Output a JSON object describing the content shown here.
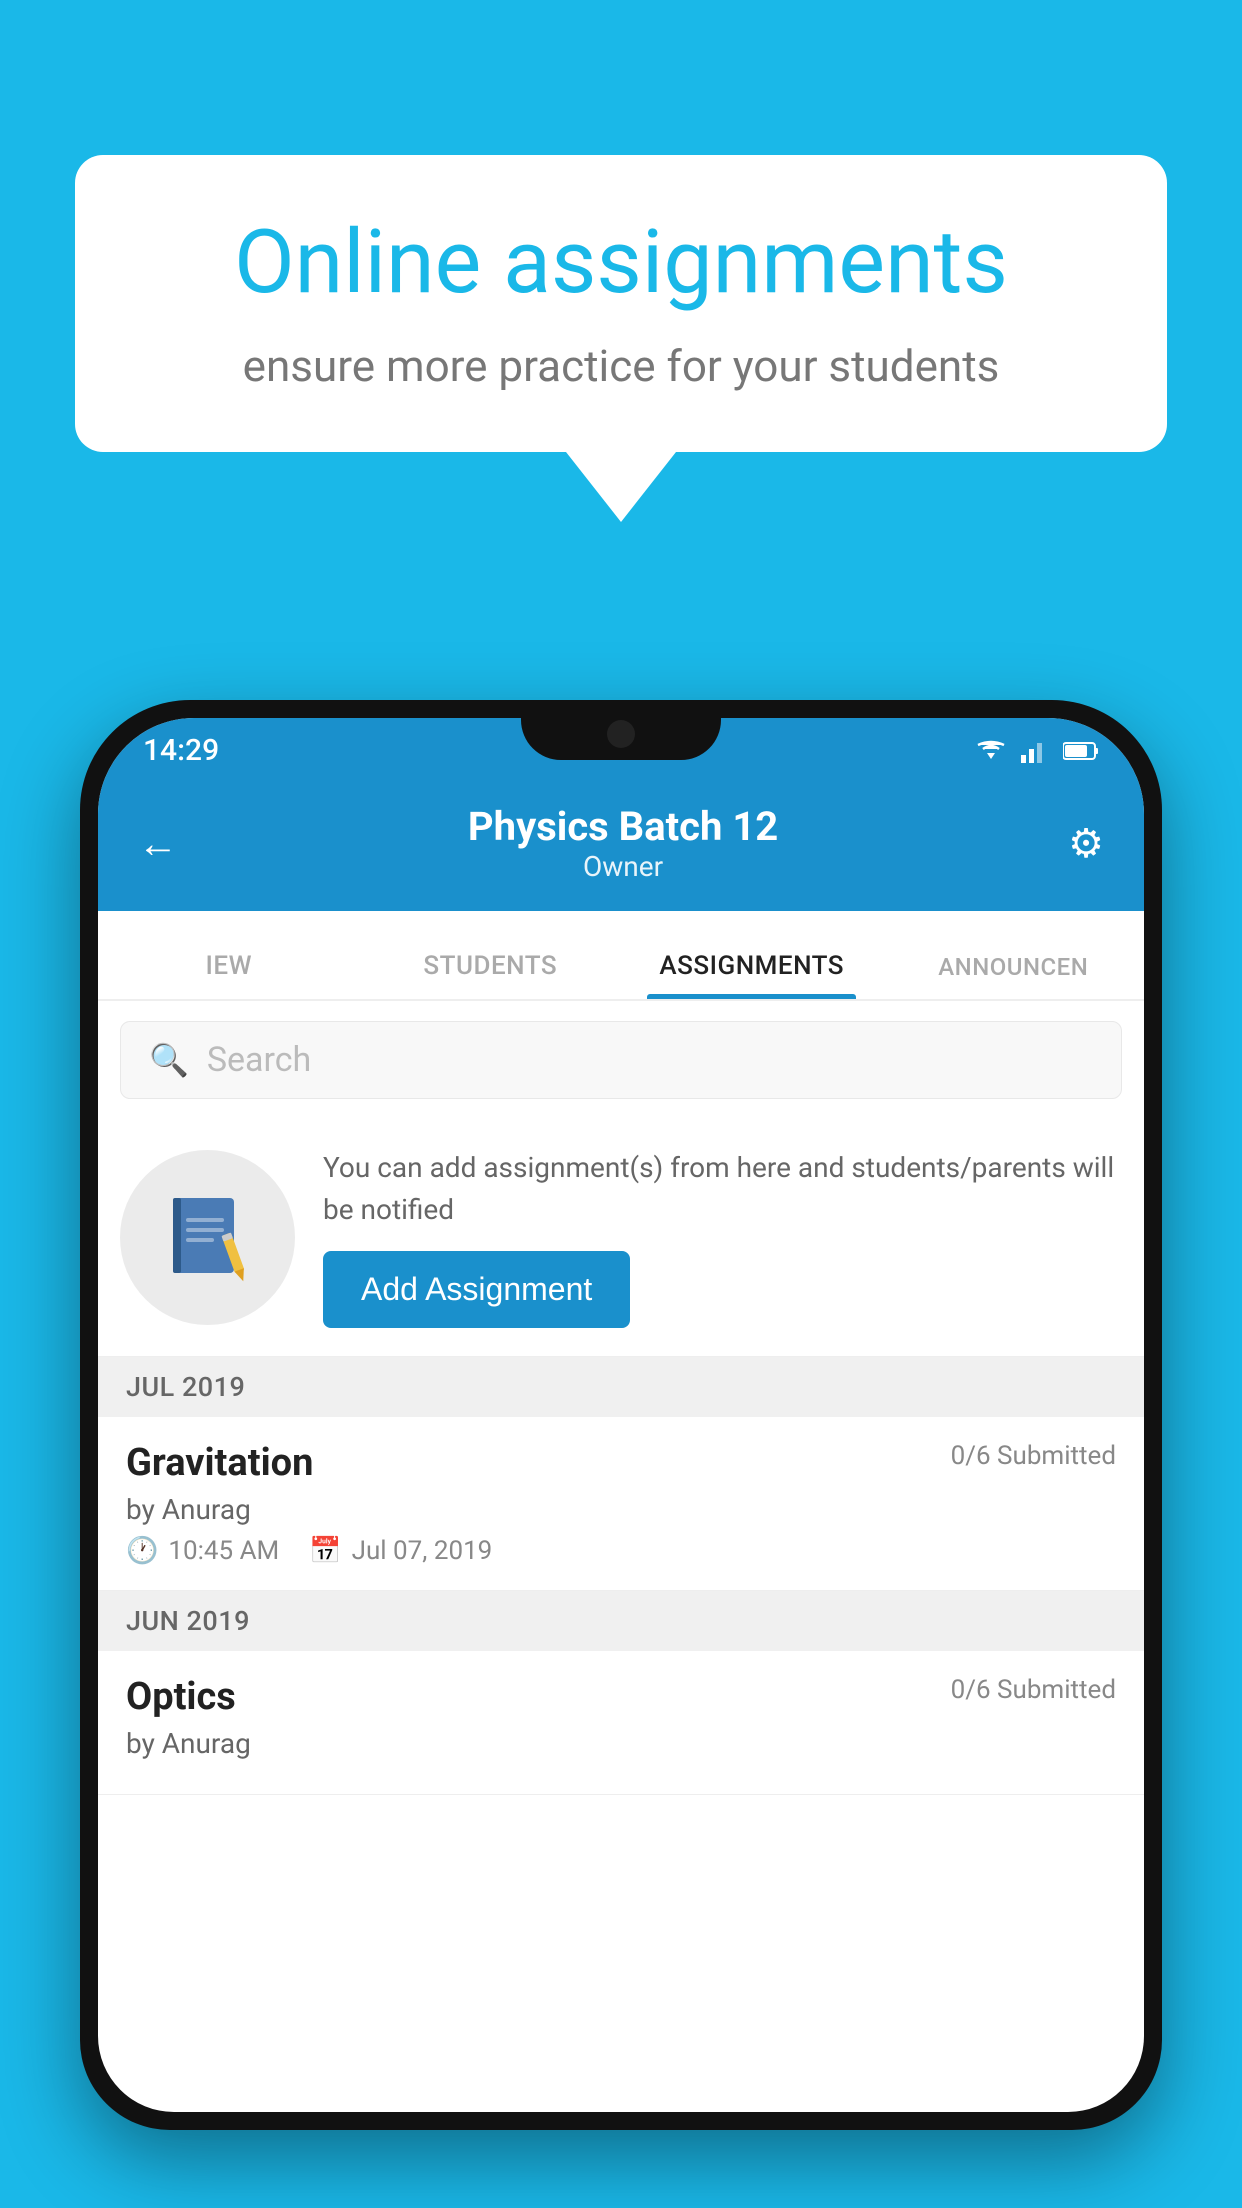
{
  "background_color": "#1ab8e8",
  "speech_bubble": {
    "title": "Online assignments",
    "subtitle": "ensure more practice for your students"
  },
  "phone": {
    "status_bar": {
      "time": "14:29"
    },
    "header": {
      "title": "Physics Batch 12",
      "subtitle": "Owner",
      "back_label": "←",
      "settings_label": "⚙"
    },
    "tabs": [
      {
        "label": "IEW",
        "active": false
      },
      {
        "label": "STUDENTS",
        "active": false
      },
      {
        "label": "ASSIGNMENTS",
        "active": true
      },
      {
        "label": "ANNOUNCEN",
        "active": false
      }
    ],
    "search": {
      "placeholder": "Search"
    },
    "promo": {
      "text": "You can add assignment(s) from here and students/parents will be notified",
      "button_label": "Add Assignment"
    },
    "sections": [
      {
        "header": "JUL 2019",
        "assignments": [
          {
            "name": "Gravitation",
            "submitted": "0/6 Submitted",
            "by": "by Anurag",
            "time": "10:45 AM",
            "date": "Jul 07, 2019"
          }
        ]
      },
      {
        "header": "JUN 2019",
        "assignments": [
          {
            "name": "Optics",
            "submitted": "0/6 Submitted",
            "by": "by Anurag",
            "time": "",
            "date": ""
          }
        ]
      }
    ]
  }
}
